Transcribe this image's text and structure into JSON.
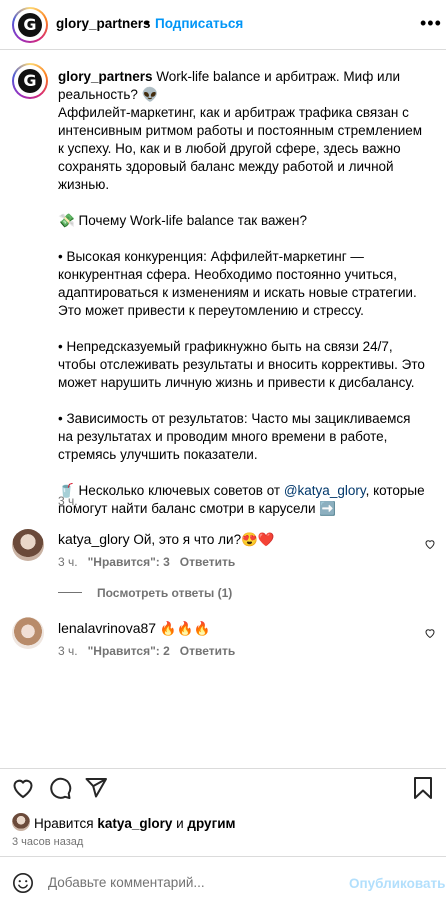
{
  "header": {
    "username": "glory_partners",
    "separator": "•",
    "follow_label": "Подписаться",
    "more": "•••"
  },
  "post": {
    "username": "glory_partners",
    "caption_first_line": " Work-life balance и арбитраж. Миф или реальность? 👽",
    "caption_body": "\nАффилейт-маркетинг, как и арбитраж трафика связан с интенсивным ритмом работы и постоянным стремлением к успеху. Но, как и в любой другой сфере, здесь важно сохранять здоровый баланс между работой и личной жизнью.\n\n💸 Почему Work-life balance так важен?\n\n• Высокая конкуренция: Аффилейт-маркетинг — конкурентная сфера. Необходимо постоянно учиться, адаптироваться к изменениям и искать новые стратегии. Это может привести к переутомлению и стрессу.\n\n• Непредсказуемый графикнужно быть на связи 24/7, чтобы отслеживать результаты и вносить коррективы. Это может нарушить личную жизнь и привести к дисбалансу.\n\n• Зависимость от результатов: Часто мы зацикливаемся на результатах и проводим много времени в работе, стремясь улучшить показатели.\n\n🥤 Несколько ключевых советов от ",
    "caption_mention": "@katya_glory",
    "caption_end": ", которые помогут найти баланс смотри в карусели ➡️",
    "time": "3 ч."
  },
  "comments": [
    {
      "username": "katya_glory",
      "text": " Ой, это я что ли?😍❤️",
      "time": "3 ч.",
      "likes": "\"Нравится\": 3",
      "reply": "Ответить",
      "view_replies": "Посмотреть ответы (1)"
    },
    {
      "username": "lenalavrinova87",
      "text": " 🔥🔥🔥",
      "time": "3 ч.",
      "likes": "\"Нравится\": 2",
      "reply": "Ответить"
    }
  ],
  "likes": {
    "prefix": "Нравится ",
    "user": "katya_glory",
    "middle": " и ",
    "others": "другим"
  },
  "posted_ago": "3 часов назад",
  "comment_box": {
    "placeholder": "Добавьте комментарий...",
    "publish_label": "Опубликовать"
  },
  "icons": [
    "more-icon",
    "heart-icon",
    "comment-icon",
    "share-icon",
    "bookmark-icon",
    "emoji-icon"
  ]
}
